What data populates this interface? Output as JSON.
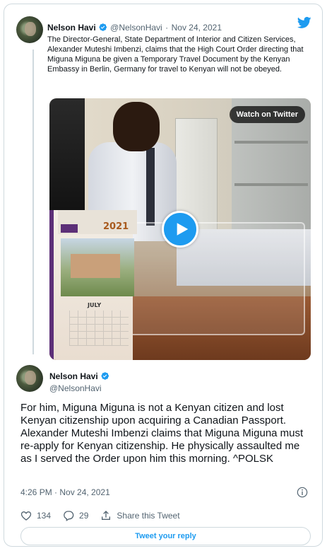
{
  "quoted_tweet": {
    "author_name": "Nelson Havi",
    "author_handle": "@NelsonHavi",
    "separator": "·",
    "date": "Nov 24, 2021",
    "text": "The Director-General, State Department of Interior and Citizen Services, Alexander Muteshi Imbenzi, claims that the High Court Order directing that Miguna Miguna be given a Temporary Travel Document by the Kenyan Embassy in Berlin, Germany for travel to Kenyan will not be obeyed.",
    "video": {
      "watch_label": "Watch on Twitter",
      "calendar_year": "2021",
      "calendar_month": "JULY"
    }
  },
  "main_tweet": {
    "author_name": "Nelson Havi",
    "author_handle": "@NelsonHavi",
    "text": "For him, Miguna Miguna is not a Kenyan citizen and lost Kenyan citizenship upon acquiring a Canadian Passport. Alexander Muteshi Imbenzi claims that Miguna Miguna must re-apply for Kenyan citizenship. He physically assaulted me as I served the Order upon him this morning. ^POLSK",
    "timestamp": "4:26 PM · Nov 24, 2021"
  },
  "actions": {
    "likes": "134",
    "replies": "29",
    "share_label": "Share this Tweet"
  },
  "reply_button_label": "Tweet your reply",
  "colors": {
    "accent": "#1d9bf0",
    "muted": "#536471",
    "border": "#cfd9de"
  },
  "icons": [
    "twitter-bird-icon",
    "verified-badge-icon",
    "play-icon",
    "info-icon",
    "heart-icon",
    "reply-bubble-icon",
    "share-icon"
  ]
}
